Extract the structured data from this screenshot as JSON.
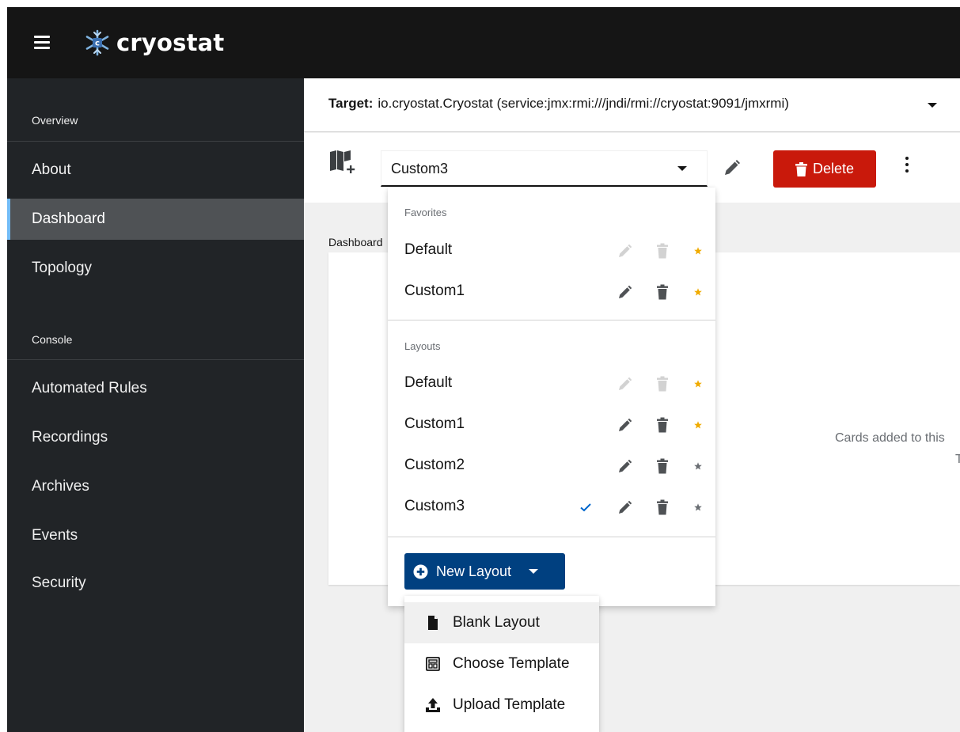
{
  "masthead": {
    "brand": "cryostat",
    "icons": {
      "menu": "hamburger-icon",
      "logo": "snowflake-logo"
    }
  },
  "sidebar": {
    "sections": [
      {
        "title": "Overview",
        "items": [
          "About",
          "Dashboard",
          "Topology"
        ]
      },
      {
        "title": "Console",
        "items": [
          "Automated Rules",
          "Recordings",
          "Archives",
          "Events",
          "Security"
        ]
      }
    ],
    "active_item": "Dashboard"
  },
  "target": {
    "label": "Target:",
    "value": "io.cryostat.Cryostat (service:jmx:rmi:///jndi/rmi://cryostat:9091/jmxrmi)"
  },
  "toolbar": {
    "selected_layout": "Custom3",
    "delete_label": "Delete",
    "icons": {
      "layout": "layout-add-icon",
      "edit": "pencil-icon",
      "more": "kebab-icon"
    }
  },
  "main": {
    "crumb": "Dashboard",
    "empty_text_1": "Cards added to this",
    "empty_text_2": "T"
  },
  "layout_menu": {
    "favorites_title": "Favorites",
    "favorites": [
      {
        "label": "Default",
        "editable": false,
        "favorite": true,
        "selected": false
      },
      {
        "label": "Custom1",
        "editable": true,
        "favorite": true,
        "selected": false
      }
    ],
    "layouts_title": "Layouts",
    "layouts": [
      {
        "label": "Default",
        "editable": false,
        "favorite": true,
        "selected": false
      },
      {
        "label": "Custom1",
        "editable": true,
        "favorite": true,
        "selected": false
      },
      {
        "label": "Custom2",
        "editable": true,
        "favorite": false,
        "selected": false
      },
      {
        "label": "Custom3",
        "editable": true,
        "favorite": false,
        "selected": true
      }
    ],
    "new_layout_label": "New Layout"
  },
  "new_layout_menu": {
    "items": [
      {
        "label": "Blank Layout",
        "icon": "file-icon"
      },
      {
        "label": "Choose Template",
        "icon": "template-icon"
      },
      {
        "label": "Upload Template",
        "icon": "upload-icon"
      }
    ]
  },
  "colors": {
    "masthead": "#151515",
    "sidebar": "#212427",
    "active_nav": "#4f5255",
    "active_accent": "#73bcf7",
    "danger": "#c9190b",
    "primary": "#004080",
    "favorite_star": "#f0ab00",
    "check": "#0066cc"
  }
}
